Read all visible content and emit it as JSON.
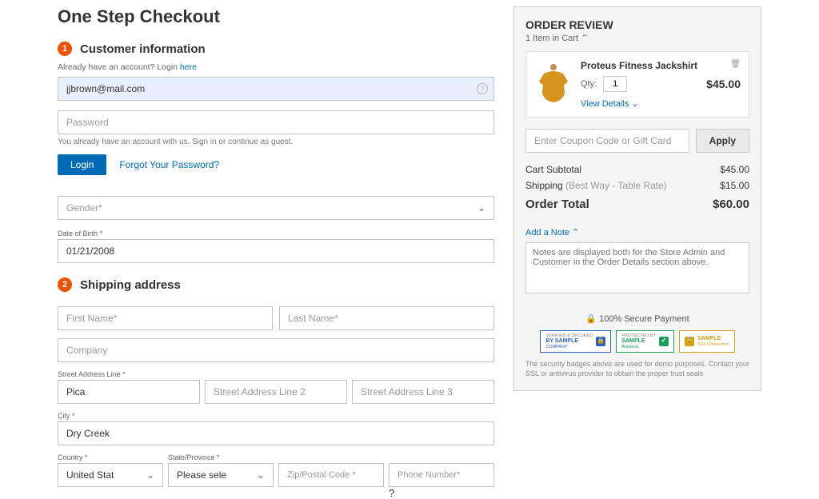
{
  "page": {
    "title": "One Step Checkout"
  },
  "customer": {
    "heading": "Customer information",
    "step": "1",
    "already_prefix": "Already have an account? Login ",
    "already_link": "here",
    "email_value": "jjbrown@mail.com",
    "password_placeholder": "Password",
    "existing_note": "You already have an account with us. Sign in or continue as guest.",
    "login_label": "Login",
    "forgot_label": "Forgot Your Password?",
    "gender_placeholder": "Gender*",
    "dob_label": "Date of Birth *",
    "dob_value": "01/21/2008"
  },
  "shipping": {
    "heading": "Shipping address",
    "step": "2",
    "first_name_placeholder": "First Name*",
    "last_name_placeholder": "Last Name*",
    "company_placeholder": "Company",
    "street_label": "Street Address Line *",
    "street1_value": "Pica",
    "street2_placeholder": "Street Address Line 2",
    "street3_placeholder": "Street Address Line 3",
    "city_label": "City *",
    "city_value": "Dry Creek",
    "country_label": "Country *",
    "country_value": "United Stat",
    "state_label": "State/Province *",
    "state_value": "Please sele",
    "zip_label": "Zip/Postal Code *",
    "phone_placeholder": "Phone Number*"
  },
  "review": {
    "heading": "ORDER REVIEW",
    "cart_count": "1 Item in Cart",
    "item": {
      "name": "Proteus Fitness Jackshirt",
      "qty_label": "Qty:",
      "qty": "1",
      "price": "$45.00",
      "view_details": "View Details"
    },
    "coupon_placeholder": "Enter Coupon Code or Gift Card",
    "apply_label": "Apply",
    "subtotal_label": "Cart Subtotal",
    "subtotal_value": "$45.00",
    "shipping_label": "Shipping",
    "shipping_detail": " (Best Way - Table Rate)",
    "shipping_value": "$15.00",
    "total_label": "Order Total",
    "total_value": "$60.00",
    "add_note_label": "Add a Note",
    "note_placeholder": "Notes are displayed both for the Store Admin and Customer in the Order Details section above.",
    "secure_label": "100% Secure Payment",
    "badges": {
      "b1": {
        "top": "VERIFIED & SECURED",
        "main": "BY SAMPLE",
        "sub": "COMPANY"
      },
      "b2": {
        "top": "PROTECTED BY",
        "main": "SAMPLE",
        "sub": "Antivirus"
      },
      "b3": {
        "main": "SAMPLE",
        "sub": "SSL Connection"
      }
    },
    "disclaimer": "The security badges above are used for demo purposes. Contact your SSL or antivirus provider to obtain the proper trust seals"
  }
}
